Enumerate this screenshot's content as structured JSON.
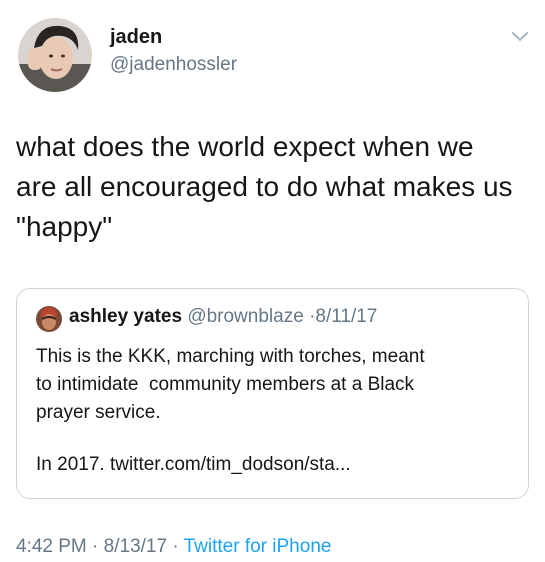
{
  "tweet": {
    "display_name": "jaden",
    "handle": "@jadenhossler",
    "avatar_icon": "user-avatar-photo",
    "menu_icon": "chevron-down-icon",
    "text": "what does the world expect when we\nare all encouraged to do what makes us\n\"happy\""
  },
  "quoted_tweet": {
    "display_name": "ashley yates",
    "handle": "@brownblaze",
    "separator": "·",
    "date": "8/11/17",
    "body_paragraph_1": "This is the KKK, marching with torches, meant\nto intimidate  community members at a Black\nprayer service.",
    "body_paragraph_2": "In 2017. twitter.com/tim_dodson/sta..."
  },
  "footer": {
    "time": "4:42 PM",
    "sep1": "·",
    "date": "8/13/17",
    "sep2": "·",
    "source": "Twitter for iPhone"
  },
  "colors": {
    "text_primary": "#14171a",
    "text_secondary": "#657786",
    "link": "#1da1f2",
    "border": "#ccd6dd"
  }
}
